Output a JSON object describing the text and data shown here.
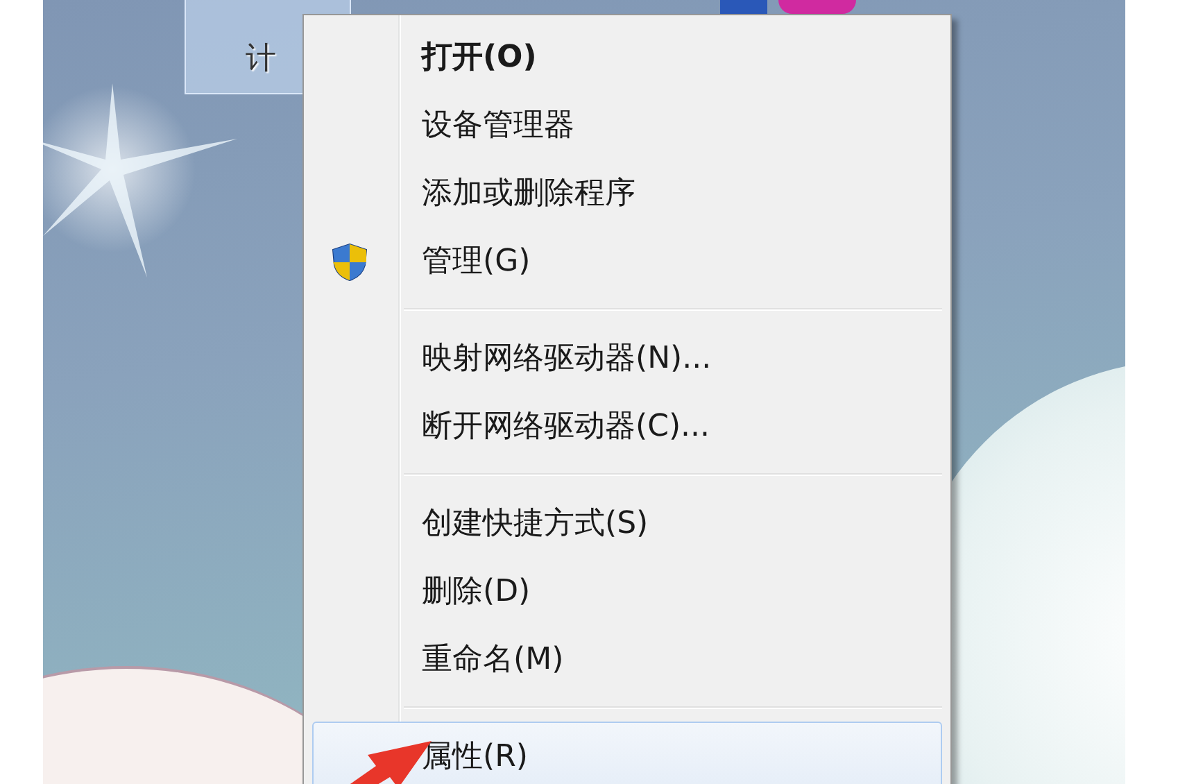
{
  "desktop": {
    "icon_label": "计"
  },
  "context_menu": {
    "items": [
      {
        "kind": "item",
        "label": "打开(O)",
        "default": true,
        "shield": false,
        "selected": false
      },
      {
        "kind": "item",
        "label": "设备管理器",
        "default": false,
        "shield": false,
        "selected": false
      },
      {
        "kind": "item",
        "label": "添加或删除程序",
        "default": false,
        "shield": false,
        "selected": false
      },
      {
        "kind": "item",
        "label": "管理(G)",
        "default": false,
        "shield": true,
        "selected": false
      },
      {
        "kind": "separator"
      },
      {
        "kind": "item",
        "label": "映射网络驱动器(N)...",
        "default": false,
        "shield": false,
        "selected": false
      },
      {
        "kind": "item",
        "label": "断开网络驱动器(C)...",
        "default": false,
        "shield": false,
        "selected": false
      },
      {
        "kind": "separator"
      },
      {
        "kind": "item",
        "label": "创建快捷方式(S)",
        "default": false,
        "shield": false,
        "selected": false
      },
      {
        "kind": "item",
        "label": "删除(D)",
        "default": false,
        "shield": false,
        "selected": false
      },
      {
        "kind": "item",
        "label": "重命名(M)",
        "default": false,
        "shield": false,
        "selected": false
      },
      {
        "kind": "separator"
      },
      {
        "kind": "item",
        "label": "属性(R)",
        "default": false,
        "shield": false,
        "selected": true
      }
    ]
  }
}
